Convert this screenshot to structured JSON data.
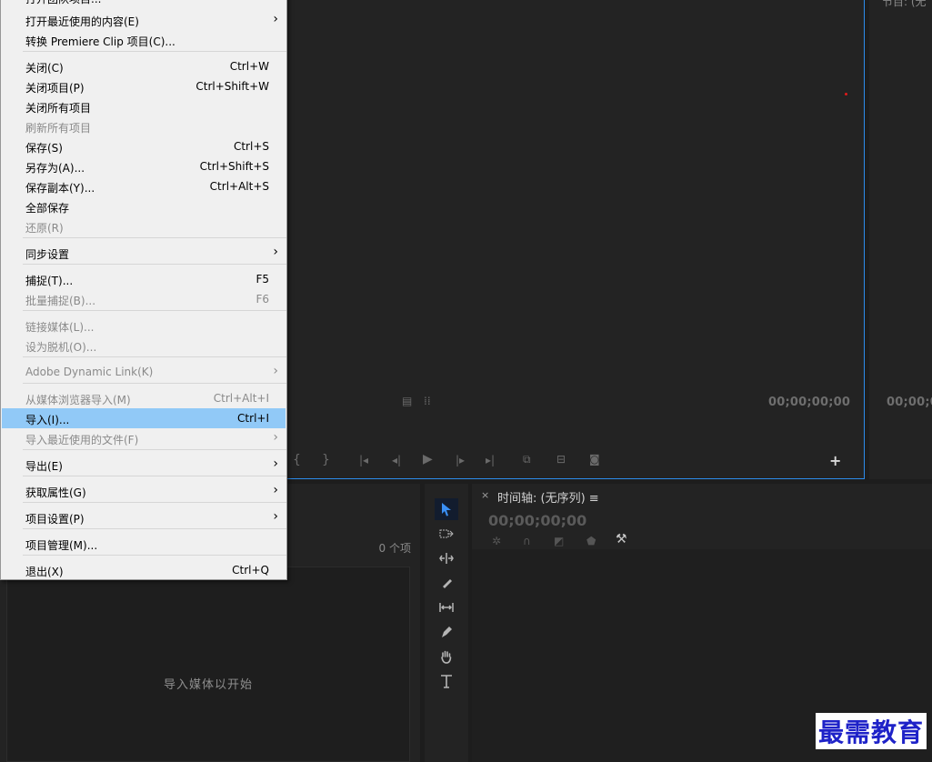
{
  "menu": {
    "items": [
      {
        "label": "打开团队项目...",
        "shortcut": "",
        "arrow": "",
        "disabled": false,
        "highlight": false
      },
      {
        "label": "打开最近使用的内容(E)",
        "shortcut": "",
        "arrow": "›",
        "disabled": false,
        "highlight": false
      },
      {
        "label": "转换 Premiere Clip 项目(C)...",
        "shortcut": "",
        "arrow": "",
        "disabled": false,
        "highlight": false
      },
      {
        "label": "关闭(C)",
        "shortcut": "Ctrl+W",
        "arrow": "",
        "disabled": false,
        "highlight": false
      },
      {
        "label": "关闭项目(P)",
        "shortcut": "Ctrl+Shift+W",
        "arrow": "",
        "disabled": false,
        "highlight": false
      },
      {
        "label": "关闭所有项目",
        "shortcut": "",
        "arrow": "",
        "disabled": false,
        "highlight": false
      },
      {
        "label": "刷新所有项目",
        "shortcut": "",
        "arrow": "",
        "disabled": true,
        "highlight": false
      },
      {
        "label": "保存(S)",
        "shortcut": "Ctrl+S",
        "arrow": "",
        "disabled": false,
        "highlight": false
      },
      {
        "label": "另存为(A)...",
        "shortcut": "Ctrl+Shift+S",
        "arrow": "",
        "disabled": false,
        "highlight": false
      },
      {
        "label": "保存副本(Y)...",
        "shortcut": "Ctrl+Alt+S",
        "arrow": "",
        "disabled": false,
        "highlight": false
      },
      {
        "label": "全部保存",
        "shortcut": "",
        "arrow": "",
        "disabled": false,
        "highlight": false
      },
      {
        "label": "还原(R)",
        "shortcut": "",
        "arrow": "",
        "disabled": true,
        "highlight": false
      },
      {
        "label": "同步设置",
        "shortcut": "",
        "arrow": "›",
        "disabled": false,
        "highlight": false
      },
      {
        "label": "捕捉(T)...",
        "shortcut": "F5",
        "arrow": "",
        "disabled": false,
        "highlight": false
      },
      {
        "label": "批量捕捉(B)...",
        "shortcut": "F6",
        "arrow": "",
        "disabled": true,
        "highlight": false
      },
      {
        "label": "链接媒体(L)...",
        "shortcut": "",
        "arrow": "",
        "disabled": true,
        "highlight": false
      },
      {
        "label": "设为脱机(O)...",
        "shortcut": "",
        "arrow": "",
        "disabled": true,
        "highlight": false
      },
      {
        "label": "Adobe Dynamic Link(K)",
        "shortcut": "",
        "arrow": "›",
        "disabled": true,
        "highlight": false
      },
      {
        "label": "从媒体浏览器导入(M)",
        "shortcut": "Ctrl+Alt+I",
        "arrow": "",
        "disabled": true,
        "highlight": false
      },
      {
        "label": "导入(I)...",
        "shortcut": "Ctrl+I",
        "arrow": "",
        "disabled": false,
        "highlight": true
      },
      {
        "label": "导入最近使用的文件(F)",
        "shortcut": "",
        "arrow": "›",
        "disabled": true,
        "highlight": false
      },
      {
        "label": "导出(E)",
        "shortcut": "",
        "arrow": "›",
        "disabled": false,
        "highlight": false
      },
      {
        "label": "获取属性(G)",
        "shortcut": "",
        "arrow": "›",
        "disabled": false,
        "highlight": false
      },
      {
        "label": "项目设置(P)",
        "shortcut": "",
        "arrow": "›",
        "disabled": false,
        "highlight": false
      },
      {
        "label": "项目管理(M)...",
        "shortcut": "",
        "arrow": "",
        "disabled": false,
        "highlight": false
      },
      {
        "label": "退出(X)",
        "shortcut": "Ctrl+Q",
        "arrow": "",
        "disabled": false,
        "highlight": false
      }
    ]
  },
  "source": {
    "timecode": "00;00;00;00"
  },
  "program": {
    "label": "节目: (无",
    "timecode": "00;00;0"
  },
  "project": {
    "count": "0 个项",
    "hint": "导入媒体以开始"
  },
  "timeline": {
    "close": "×",
    "title": "时间轴: (无序列) ≡",
    "timecode": "00;00;00;00"
  },
  "watermark": "最需教育"
}
